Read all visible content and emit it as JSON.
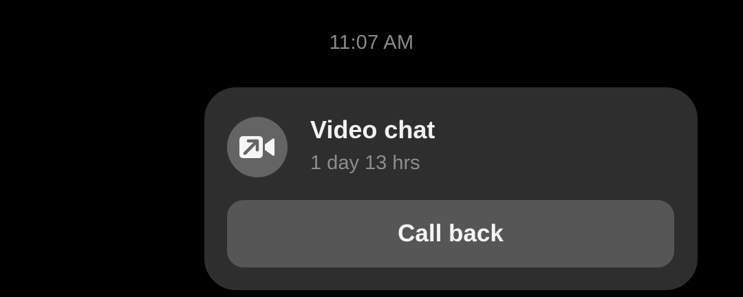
{
  "timestamp": "11:07 AM",
  "call_card": {
    "icon": "outgoing-video-call-icon",
    "title": "Video chat",
    "duration": "1 day 13 hrs",
    "action_label": "Call back"
  },
  "colors": {
    "background": "#000000",
    "card": "#2e2e2e",
    "icon_circle": "#646464",
    "button": "#565656",
    "primary_text": "#f2f2f2",
    "secondary_text": "#8d8d8d"
  }
}
